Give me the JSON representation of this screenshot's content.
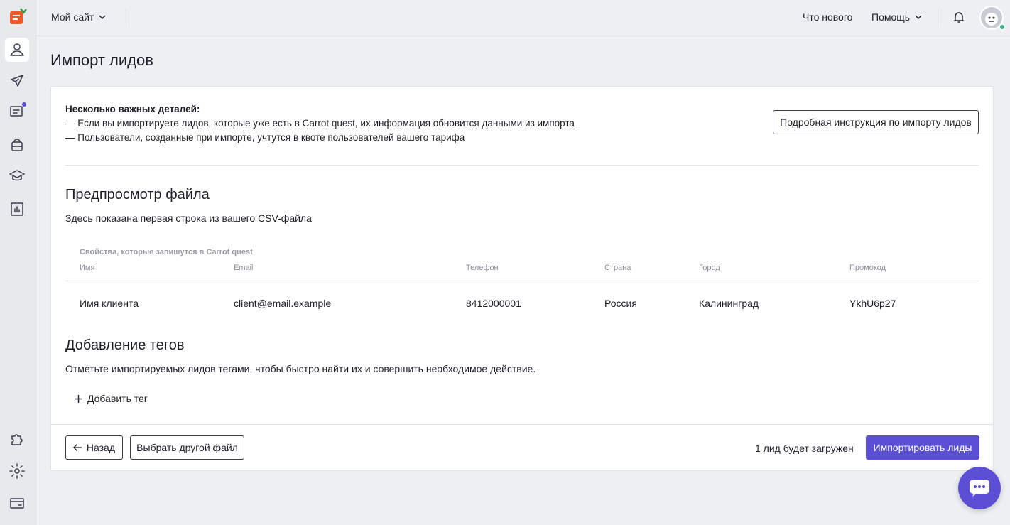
{
  "colors": {
    "accent": "#5b4fd6",
    "logo": "#f05a28",
    "online": "#36b37e"
  },
  "topbar": {
    "site_label": "Мой сайт",
    "whats_new": "Что нового",
    "help": "Помощь"
  },
  "sidebar": {
    "items": [
      {
        "icon": "users-icon",
        "active": true
      },
      {
        "icon": "rocket-icon"
      },
      {
        "icon": "chat-icon",
        "badge": true
      },
      {
        "icon": "bot-icon"
      },
      {
        "icon": "graduation-cap-icon"
      },
      {
        "icon": "analytics-icon"
      },
      {
        "icon": "puzzle-icon"
      },
      {
        "icon": "gear-icon"
      },
      {
        "icon": "billing-card-icon"
      }
    ]
  },
  "page": {
    "title": "Импорт лидов",
    "notes_title": "Несколько важных деталей:",
    "notes_line1": "— Если вы импортируете лидов, которые уже есть в Carrot quest, их информация обновится данными из импорта",
    "notes_line2": "— Пользователи, созданные при импорте, учтутся в квоте пользователей вашего тарифа",
    "instruction_button": "Подробная инструкция по импорту лидов",
    "preview_title": "Предпросмотр файла",
    "preview_sub": "Здесь показана первая строка из вашего CSV-файла",
    "props_caption": "Свойства, которые запишутся в Carrot quest",
    "columns": [
      "Имя",
      "Email",
      "Телефон",
      "Страна",
      "Город",
      "Промокод"
    ],
    "row": [
      "Имя клиента",
      "client@email.example",
      "8412000001",
      "Россия",
      "Калининград",
      "YkhU6p27"
    ],
    "tags_title": "Добавление тегов",
    "tags_sub": "Отметьте импортируемых лидов тегами, чтобы быстро найти их и совершить необходимое действие.",
    "add_tag": "Добавить тег"
  },
  "footer": {
    "back": "Назад",
    "choose_file": "Выбрать другой файл",
    "status": "1 лид будет загружен",
    "import": "Импортировать лиды"
  }
}
